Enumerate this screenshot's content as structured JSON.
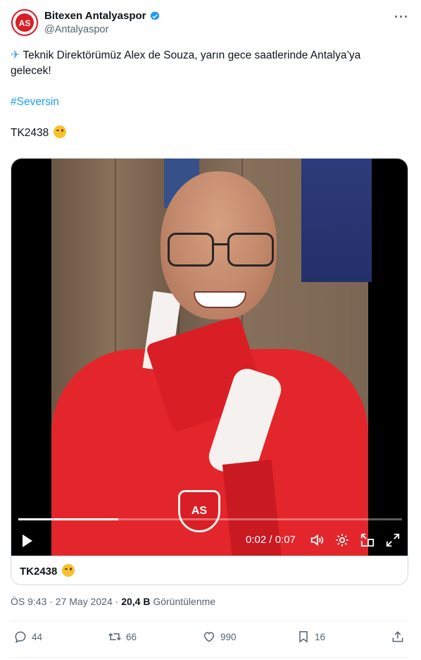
{
  "account": {
    "name": "Bitexen Antalyaspor",
    "handle": "@Antalyaspor",
    "verified": true,
    "avatar_text": "AS"
  },
  "tweet": {
    "line1": "Teknik Direktörümüz Alex de Souza, yarın gece saatlerinde Antalya’ya",
    "line2": "gelecek!",
    "hashtag": "#Seversin",
    "flight": "TK2438"
  },
  "video": {
    "time_display": "0:02 / 0:07",
    "progress": 0.26,
    "badge_text": "AS",
    "caption": "TK2438"
  },
  "meta": {
    "time": "ÖS 9:43 · 27 May 2024 · ",
    "views": "20,4 B",
    "views_label": "Görüntülenme"
  },
  "actions": {
    "replies": "44",
    "reposts": "66",
    "likes": "990",
    "bookmarks": "16"
  },
  "colors": {
    "accent": "#1d9bf0",
    "muted": "#536471",
    "text": "#0f1419",
    "club_red": "#e3262b"
  },
  "icons": [
    "verified-icon",
    "more-icon",
    "airplane-icon",
    "wink-emoji-icon",
    "play-icon",
    "volume-icon",
    "settings-icon",
    "pip-icon",
    "fullscreen-icon",
    "reply-icon",
    "repost-icon",
    "like-icon",
    "bookmark-icon",
    "share-icon"
  ]
}
